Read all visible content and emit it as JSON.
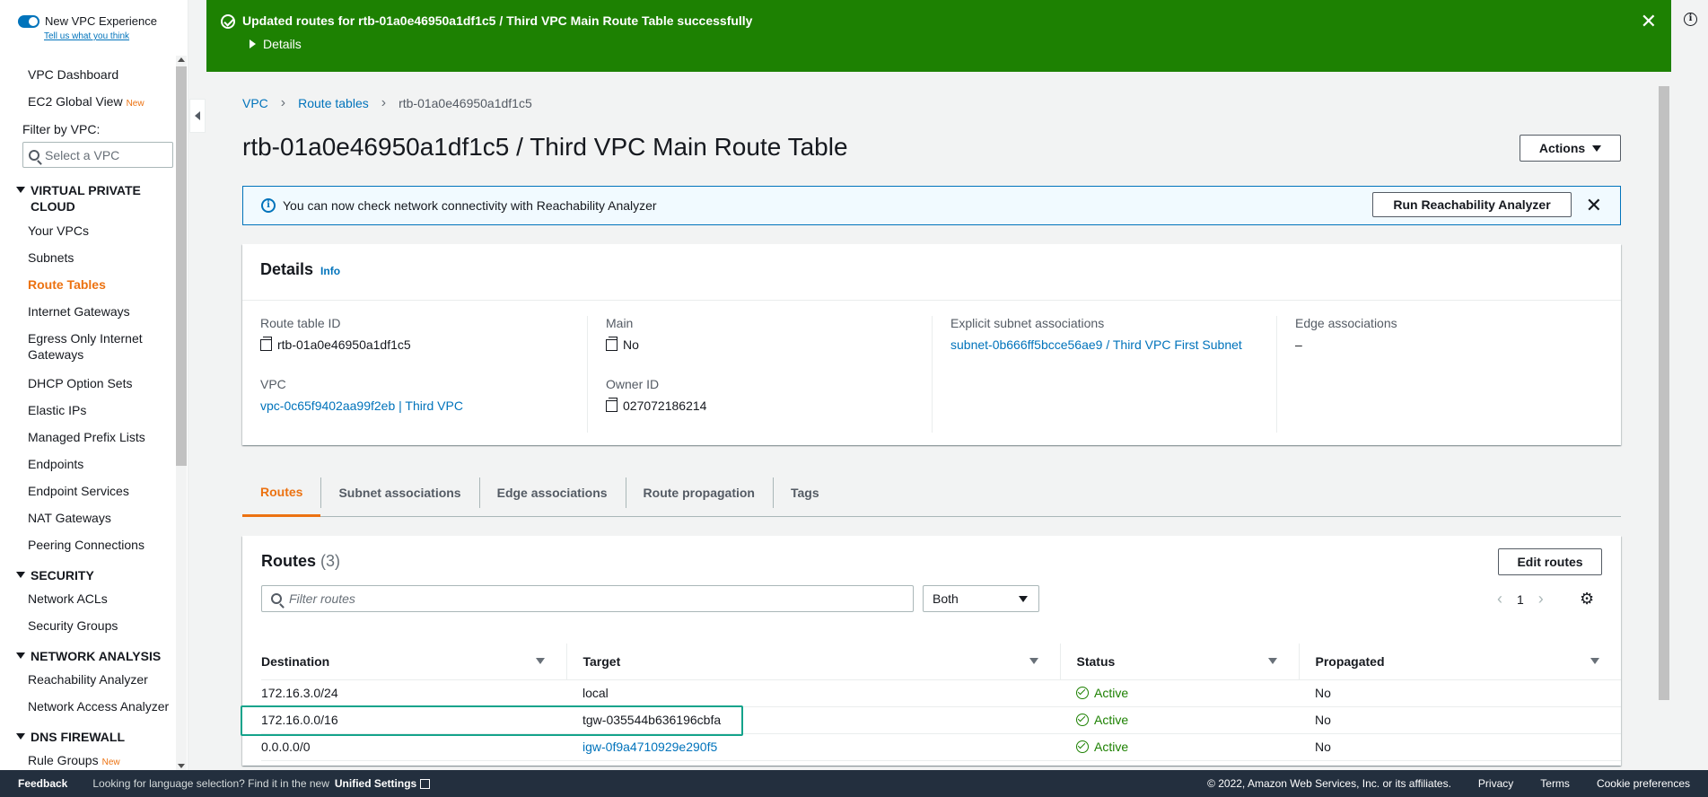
{
  "sidebar": {
    "vpc_experience": "New VPC Experience",
    "tell_us": "Tell us what you think",
    "dashboard": "VPC Dashboard",
    "ec2_global": "EC2 Global View",
    "new_badge": "New",
    "filter_label": "Filter by VPC:",
    "select_placeholder": "Select a VPC",
    "sections": {
      "vpc": "VIRTUAL PRIVATE CLOUD",
      "security": "SECURITY",
      "network_analysis": "NETWORK ANALYSIS",
      "dns_firewall": "DNS FIREWALL"
    },
    "vpc_items": [
      "Your VPCs",
      "Subnets",
      "Route Tables",
      "Internet Gateways",
      "Egress Only Internet Gateways",
      "DHCP Option Sets",
      "Elastic IPs",
      "Managed Prefix Lists",
      "Endpoints",
      "Endpoint Services",
      "NAT Gateways",
      "Peering Connections"
    ],
    "security_items": [
      "Network ACLs",
      "Security Groups"
    ],
    "analysis_items": [
      "Reachability Analyzer",
      "Network Access Analyzer"
    ],
    "dns_items": [
      "Rule Groups"
    ]
  },
  "flash": {
    "message": "Updated routes for rtb-01a0e46950a1df1c5 / Third VPC Main Route Table successfully",
    "details": "Details",
    "close": "✕"
  },
  "breadcrumb": [
    "VPC",
    "Route tables",
    "rtb-01a0e46950a1df1c5"
  ],
  "page_title": "rtb-01a0e46950a1df1c5 / Third VPC Main Route Table",
  "actions_label": "Actions",
  "banner": {
    "text": "You can now check network connectivity with Reachability Analyzer",
    "button": "Run Reachability Analyzer",
    "close": "✕"
  },
  "details": {
    "title": "Details",
    "info": "Info",
    "route_table_id_label": "Route table ID",
    "route_table_id": "rtb-01a0e46950a1df1c5",
    "vpc_label": "VPC",
    "vpc": "vpc-0c65f9402aa99f2eb | Third VPC",
    "main_label": "Main",
    "main": "No",
    "owner_label": "Owner ID",
    "owner": "027072186214",
    "explicit_label": "Explicit subnet associations",
    "explicit": "subnet-0b666ff5bcce56ae9 / Third VPC First Subnet",
    "edge_label": "Edge associations",
    "edge": "–"
  },
  "tabs": [
    "Routes",
    "Subnet associations",
    "Edge associations",
    "Route propagation",
    "Tags"
  ],
  "routes": {
    "title": "Routes",
    "count": "(3)",
    "edit": "Edit routes",
    "filter_placeholder": "Filter routes",
    "filter_select": "Both",
    "page": "1",
    "columns": [
      "Destination",
      "Target",
      "Status",
      "Propagated"
    ],
    "rows": [
      {
        "destination": "172.16.3.0/24",
        "target": "local",
        "status": "Active",
        "propagated": "No"
      },
      {
        "destination": "172.16.0.0/16",
        "target": "tgw-035544b636196cbfa",
        "status": "Active",
        "propagated": "No"
      },
      {
        "destination": "0.0.0.0/0",
        "target": "igw-0f9a4710929e290f5",
        "status": "Active",
        "propagated": "No"
      }
    ]
  },
  "footer": {
    "feedback": "Feedback",
    "lang": "Looking for language selection? Find it in the new",
    "unified": "Unified Settings",
    "copyright": "© 2022, Amazon Web Services, Inc. or its affiliates.",
    "privacy": "Privacy",
    "terms": "Terms",
    "cookies": "Cookie preferences"
  },
  "colors": {
    "success": "#1d8102",
    "link": "#0073bb",
    "accent": "#ec7211",
    "highlight": "#14a38b"
  }
}
